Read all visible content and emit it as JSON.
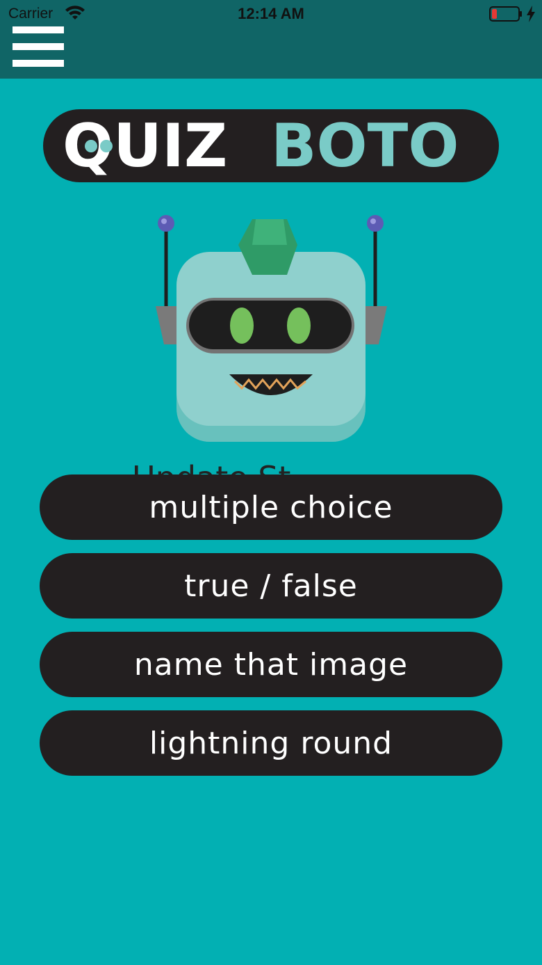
{
  "status_bar": {
    "carrier": "Carrier",
    "time": "12:14 AM"
  },
  "app": {
    "logo_part1": "QUIZ",
    "logo_part2": "BOTO"
  },
  "colors": {
    "background": "#02b0b3",
    "topbar": "#106566",
    "button": "#231f20",
    "logo_accent": "#7acbc7"
  },
  "partial_text": "Update St",
  "modes": [
    {
      "label": "multiple choice"
    },
    {
      "label": "true / false"
    },
    {
      "label": "name that image"
    },
    {
      "label": "lightning round"
    }
  ]
}
